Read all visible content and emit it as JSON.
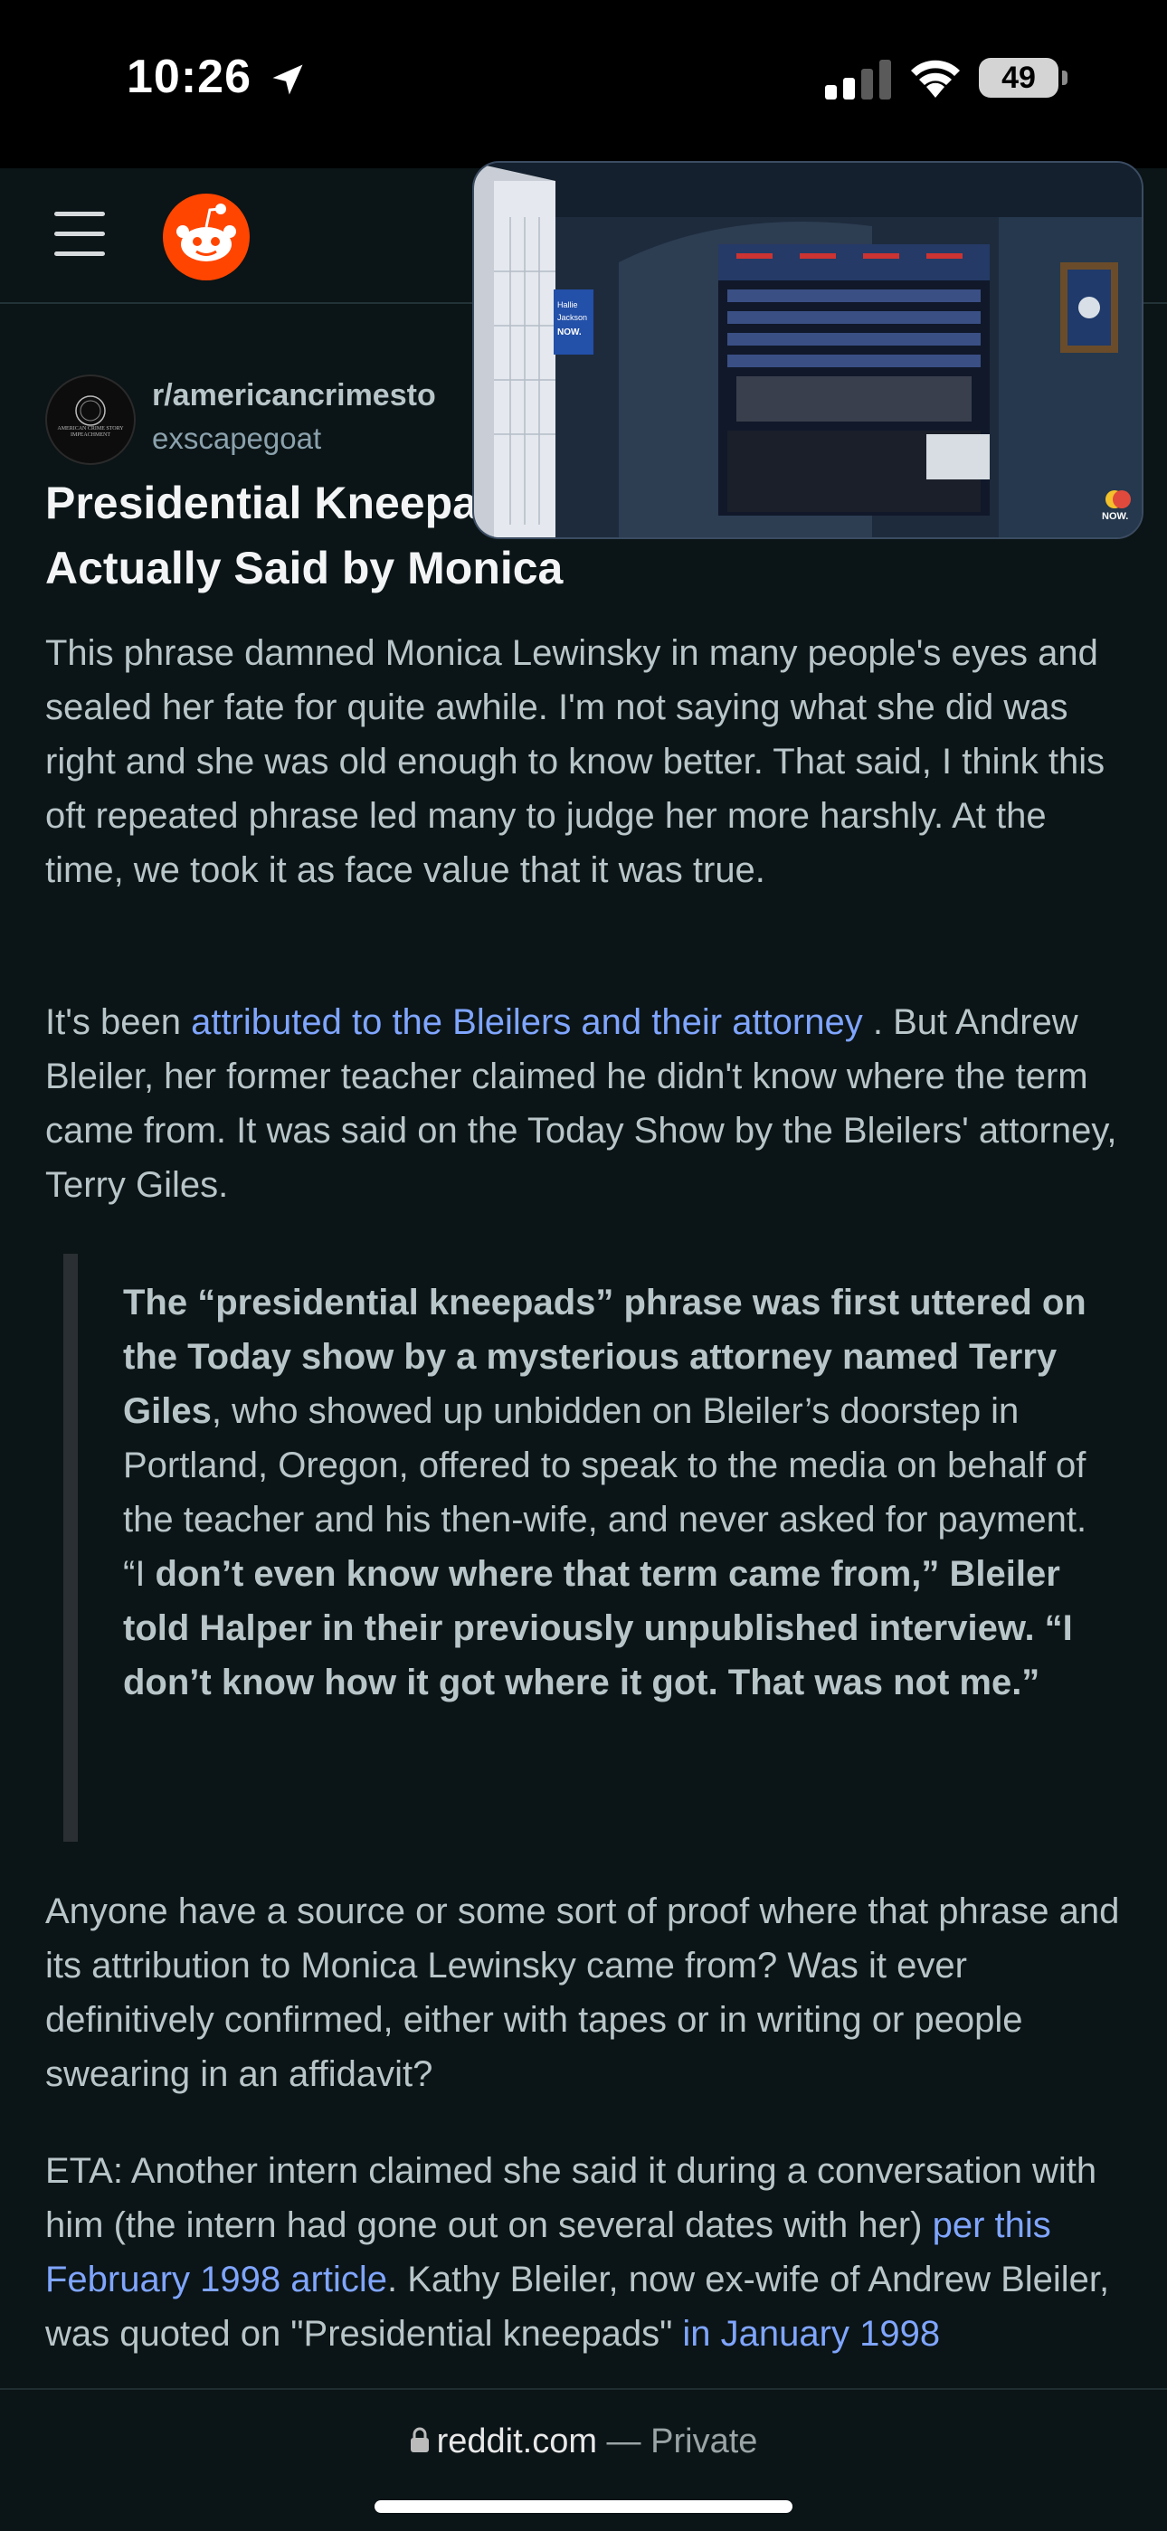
{
  "status_bar": {
    "time": "10:26",
    "battery": "49"
  },
  "header": {
    "menu_icon": "hamburger-menu-icon",
    "logo_icon": "reddit-snoo-icon"
  },
  "pip": {
    "sign_text": "Hallie Jackson NOW.",
    "network_badge": "NOW."
  },
  "post": {
    "avatar_text": "AMERICAN CRIME STORY IMPEACHMENT",
    "subreddit": "r/americancrimesto",
    "author": "exscapegoat",
    "title_line1": "Presidential Kneepa",
    "title_line2": "Actually Said by Monica",
    "paragraph1": "This phrase damned Monica Lewinsky in many people's eyes and sealed her fate for quite awhile. I'm not saying what she did was right and she was old enough to know better. That said, I think this oft repeated phrase led many to judge her more harshly. At the time, we took it as face value that it was true.",
    "p2_prefix": "It's been ",
    "p2_link": "attributed to the Bleilers and their attorney",
    "p2_suffix": " . But Andrew Bleiler, her former teacher claimed he didn't know where the term came from. It was said on the Today Show by the Bleilers' attorney, Terry Giles.",
    "quote_bold1": "The “presidential kneepads” phrase was first uttered on the Today show by a mysterious attorney named Terry Giles",
    "quote_normal": ", who showed up unbidden on Bleiler’s doorstep in Portland, Oregon, offered to speak to the media on behalf of the teacher and his then-wife, and never asked for payment. “I ",
    "quote_bold2": "don’t even know where that term came from,” Bleiler told Halper in their previously unpublished interview. “I don’t know how it got where it got. That was not me.”",
    "paragraph3": "Anyone have a source or some sort of proof where that phrase and its attribution to Monica Lewinsky came from? Was it ever definitively confirmed, either with tapes or in writing or people swearing in an affidavit?",
    "p4_prefix": "ETA: Another intern claimed she said it during a conversation with him (the intern had gone out on several dates with her) ",
    "p4_link1": "per this February 1998 article",
    "p4_middle": ". Kathy Bleiler, now ex-wife of Andrew Bleiler, was quoted on \"Presidential kneepads\" ",
    "p4_link2": "in January 1998"
  },
  "browser_bar": {
    "domain": "reddit.com",
    "separator": " — ",
    "mode": "Private"
  },
  "colors": {
    "background": "#0b1416",
    "link": "#7fa5ff",
    "reddit_orange": "#ff4500"
  }
}
